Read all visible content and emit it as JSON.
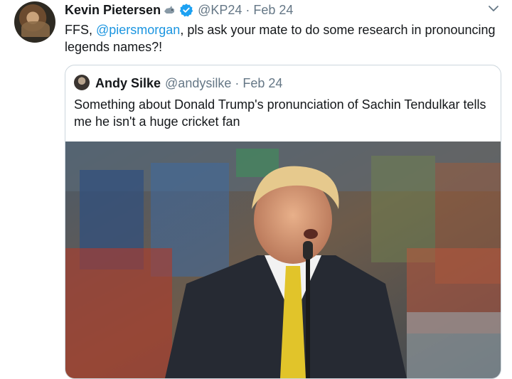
{
  "tweet": {
    "author": {
      "name": "Kevin Pietersen",
      "badge_icon": "rhino-emoji-icon",
      "verified_icon": "verified-badge-icon",
      "handle": "@KP24",
      "separator": "·",
      "date": "Feb 24"
    },
    "menu_icon": "chevron-down-icon",
    "text_parts": {
      "before": "FFS, ",
      "mention": "@piersmorgan",
      "after": ", pls ask your mate to do some research in pronouncing legends names?!"
    },
    "quoted": {
      "author": {
        "name": "Andy Silke",
        "handle": "@andysilke",
        "separator": "·",
        "date": "Feb 24"
      },
      "text": "Something about Donald Trump's pronunciation of Sachin Tendulkar tells me he isn't a huge cricket fan"
    }
  },
  "colors": {
    "text": "#14171a",
    "muted": "#657786",
    "link": "#1b95e0",
    "verified": "#1da1f2",
    "border": "#ccd6dd"
  }
}
